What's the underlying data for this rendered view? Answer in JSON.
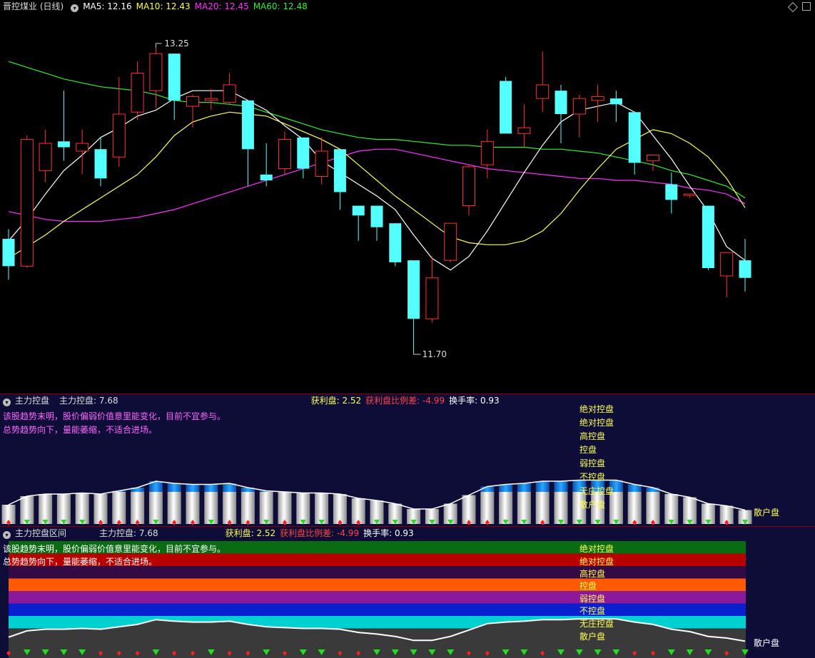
{
  "main": {
    "title": "晋控煤业 (日线)",
    "ma5_label": "MA5: 12.16",
    "ma10_label": "MA10: 12.43",
    "ma20_label": "MA20: 12.45",
    "ma60_label": "MA60: 12.48",
    "high_label": "13.25",
    "low_label": "11.70",
    "colors": {
      "up": "#ff3333",
      "down": "#54ffff",
      "ma5": "#ffffff",
      "ma10": "#ffff55",
      "ma20": "#ff33ff",
      "ma60": "#33ee33"
    }
  },
  "panel2": {
    "name": "主力控盘",
    "value_label": "主力控盘: 7.68",
    "profit_label": "获利盘: 2.52",
    "profit_ratio_label": "获利盘比例差: -4.99",
    "turnover_label": "换手率: 0.93",
    "msg1": "该股趋势末明，股价偏弱价值意里能变化，目前不宜参与。",
    "msg2": "总势趋势向下，量能萎缩，不适合进场。",
    "levels": [
      "绝对控盘",
      "绝对控盘",
      "高控盘",
      "控盘",
      "弱控盘",
      "不控盘",
      "无庄控盘",
      "散户盘"
    ],
    "end_label": "散户盘"
  },
  "panel3": {
    "name": "主力控盘区间",
    "value_label": "主力控盘: 7.68",
    "profit_label": "获利盘: 2.52",
    "profit_ratio_label": "获利盘比例差: -4.99",
    "turnover_label": "换手率: 0.93",
    "msg1": "该股趋势末明，股价偏弱价值意里能变化，目前不宜参与。",
    "msg2": "总势趋势向下，量能萎缩，不适合进场。",
    "levels": [
      "绝对控盘",
      "绝对控盘",
      "高控盘",
      "控盘",
      "弱控盘",
      "不控盘",
      "无庄控盘",
      "散户盘"
    ],
    "band_colors": [
      "#0b6b12",
      "#b80000",
      "#330a44",
      "#ff5a00",
      "#8a1a9a",
      "#0a1fd0",
      "#00d0d0",
      "#3a3a3a"
    ],
    "end_label": "散户盘"
  },
  "chart_data": [
    {
      "type": "candlestick",
      "ylim": [
        11.55,
        13.4
      ],
      "candles": [
        {
          "o": 12.27,
          "h": 12.32,
          "l": 12.06,
          "c": 12.13
        },
        {
          "o": 12.13,
          "h": 12.8,
          "l": 12.12,
          "c": 12.78
        },
        {
          "o": 12.62,
          "h": 12.83,
          "l": 12.56,
          "c": 12.76
        },
        {
          "o": 12.77,
          "h": 13.03,
          "l": 12.67,
          "c": 12.74
        },
        {
          "o": 12.72,
          "h": 12.83,
          "l": 12.6,
          "c": 12.76
        },
        {
          "o": 12.73,
          "h": 12.79,
          "l": 12.54,
          "c": 12.58
        },
        {
          "o": 12.69,
          "h": 13.1,
          "l": 12.64,
          "c": 12.91
        },
        {
          "o": 12.92,
          "h": 13.18,
          "l": 12.88,
          "c": 13.12
        },
        {
          "o": 13.03,
          "h": 13.25,
          "l": 12.94,
          "c": 13.22
        },
        {
          "o": 13.22,
          "h": 13.22,
          "l": 12.88,
          "c": 12.98
        },
        {
          "o": 12.95,
          "h": 13.01,
          "l": 12.84,
          "c": 13.0
        },
        {
          "o": 12.98,
          "h": 13.04,
          "l": 12.93,
          "c": 12.99
        },
        {
          "o": 12.97,
          "h": 13.12,
          "l": 12.96,
          "c": 13.06
        },
        {
          "o": 12.98,
          "h": 12.98,
          "l": 12.54,
          "c": 12.73
        },
        {
          "o": 12.6,
          "h": 12.76,
          "l": 12.54,
          "c": 12.57
        },
        {
          "o": 12.63,
          "h": 12.82,
          "l": 12.6,
          "c": 12.78
        },
        {
          "o": 12.79,
          "h": 12.79,
          "l": 12.58,
          "c": 12.63
        },
        {
          "o": 12.59,
          "h": 12.79,
          "l": 12.55,
          "c": 12.72
        },
        {
          "o": 12.73,
          "h": 12.73,
          "l": 12.42,
          "c": 12.51
        },
        {
          "o": 12.44,
          "h": 12.44,
          "l": 12.26,
          "c": 12.39
        },
        {
          "o": 12.44,
          "h": 12.44,
          "l": 12.26,
          "c": 12.33
        },
        {
          "o": 12.35,
          "h": 12.35,
          "l": 12.13,
          "c": 12.15
        },
        {
          "o": 12.16,
          "h": 12.16,
          "l": 11.7,
          "c": 11.86
        },
        {
          "o": 11.86,
          "h": 12.18,
          "l": 11.84,
          "c": 12.07
        },
        {
          "o": 12.16,
          "h": 12.34,
          "l": 12.15,
          "c": 12.35
        },
        {
          "o": 12.44,
          "h": 12.65,
          "l": 12.39,
          "c": 12.64
        },
        {
          "o": 12.65,
          "h": 12.83,
          "l": 12.58,
          "c": 12.77
        },
        {
          "o": 13.08,
          "h": 13.1,
          "l": 12.81,
          "c": 12.81
        },
        {
          "o": 12.81,
          "h": 12.96,
          "l": 12.74,
          "c": 12.84
        },
        {
          "o": 12.99,
          "h": 13.23,
          "l": 12.92,
          "c": 13.06
        },
        {
          "o": 13.03,
          "h": 13.06,
          "l": 12.76,
          "c": 12.91
        },
        {
          "o": 12.91,
          "h": 13.01,
          "l": 12.79,
          "c": 12.99
        },
        {
          "o": 12.98,
          "h": 13.06,
          "l": 12.87,
          "c": 13.0
        },
        {
          "o": 12.99,
          "h": 13.03,
          "l": 12.87,
          "c": 12.96
        },
        {
          "o": 12.92,
          "h": 12.92,
          "l": 12.6,
          "c": 12.66
        },
        {
          "o": 12.67,
          "h": 12.7,
          "l": 12.62,
          "c": 12.7
        },
        {
          "o": 12.55,
          "h": 12.61,
          "l": 12.4,
          "c": 12.47
        },
        {
          "o": 12.5,
          "h": 12.5,
          "l": 12.48,
          "c": 12.5
        },
        {
          "o": 12.44,
          "h": 12.44,
          "l": 12.11,
          "c": 12.12
        },
        {
          "o": 12.08,
          "h": 12.18,
          "l": 11.97,
          "c": 12.2
        },
        {
          "o": 12.16,
          "h": 12.27,
          "l": 12.0,
          "c": 12.07
        }
      ],
      "ma5": [
        12.26,
        12.37,
        12.5,
        12.62,
        12.7,
        12.79,
        12.84,
        12.9,
        12.93,
        12.99,
        13.03,
        13.03,
        13.03,
        12.98,
        12.93,
        12.85,
        12.78,
        12.67,
        12.61,
        12.55,
        12.49,
        12.42,
        12.29,
        12.17,
        12.11,
        12.18,
        12.31,
        12.46,
        12.61,
        12.75,
        12.87,
        12.93,
        12.95,
        12.97,
        12.92,
        12.8,
        12.68,
        12.54,
        12.41,
        12.23,
        12.16
      ],
      "ma10": [
        12.17,
        12.23,
        12.29,
        12.36,
        12.42,
        12.48,
        12.54,
        12.6,
        12.69,
        12.8,
        12.87,
        12.9,
        12.92,
        12.91,
        12.9,
        12.86,
        12.82,
        12.78,
        12.73,
        12.65,
        12.57,
        12.49,
        12.42,
        12.35,
        12.28,
        12.25,
        12.24,
        12.24,
        12.26,
        12.31,
        12.4,
        12.52,
        12.63,
        12.73,
        12.78,
        12.83,
        12.81,
        12.76,
        12.69,
        12.58,
        12.43
      ],
      "ma20": [
        12.41,
        12.39,
        12.37,
        12.36,
        12.36,
        12.36,
        12.37,
        12.38,
        12.4,
        12.42,
        12.45,
        12.48,
        12.51,
        12.54,
        12.57,
        12.6,
        12.63,
        12.66,
        12.69,
        12.72,
        12.73,
        12.73,
        12.71,
        12.69,
        12.67,
        12.65,
        12.63,
        12.62,
        12.61,
        12.6,
        12.59,
        12.58,
        12.58,
        12.57,
        12.57,
        12.56,
        12.55,
        12.53,
        12.52,
        12.5,
        12.45
      ],
      "ma60": [
        13.18,
        13.15,
        13.12,
        13.09,
        13.07,
        13.05,
        13.04,
        13.03,
        13.01,
        12.98,
        12.97,
        12.97,
        12.96,
        12.95,
        12.92,
        12.89,
        12.86,
        12.83,
        12.81,
        12.79,
        12.78,
        12.78,
        12.77,
        12.76,
        12.75,
        12.75,
        12.74,
        12.74,
        12.74,
        12.73,
        12.73,
        12.72,
        12.71,
        12.69,
        12.67,
        12.65,
        12.62,
        12.6,
        12.57,
        12.54,
        12.48
      ]
    },
    {
      "type": "bar",
      "name": "主力控盘",
      "ylim": [
        0,
        10
      ],
      "values": [
        3.6,
        5.2,
        5.6,
        5.6,
        5.8,
        5.6,
        6.2,
        6.8,
        8.0,
        7.6,
        7.4,
        7.4,
        7.6,
        6.8,
        6.2,
        6.0,
        5.8,
        5.8,
        5.6,
        4.8,
        4.4,
        3.8,
        2.8,
        2.8,
        3.8,
        5.4,
        7.0,
        7.4,
        7.6,
        8.0,
        8.0,
        8.2,
        8.2,
        8.2,
        7.4,
        6.8,
        5.6,
        5.0,
        3.8,
        3.4,
        2.6
      ],
      "turning": [
        0,
        0,
        0,
        1,
        0,
        0,
        1,
        0,
        0,
        0,
        0,
        0,
        1,
        0,
        0,
        1,
        0,
        0,
        0,
        0,
        0,
        0,
        1,
        1,
        0,
        0,
        1,
        0,
        0,
        1,
        0,
        0,
        0,
        0,
        0,
        1,
        0,
        0,
        0,
        0,
        0
      ],
      "signals": [
        0,
        1,
        1,
        1,
        1,
        0,
        0,
        0,
        1,
        0,
        0,
        1,
        0,
        0,
        1,
        0,
        1,
        1,
        0,
        0,
        1,
        1,
        1,
        1,
        1,
        0,
        0,
        1,
        1,
        0,
        1,
        1,
        1,
        1,
        0,
        0,
        1,
        1,
        1,
        0,
        1
      ]
    }
  ]
}
